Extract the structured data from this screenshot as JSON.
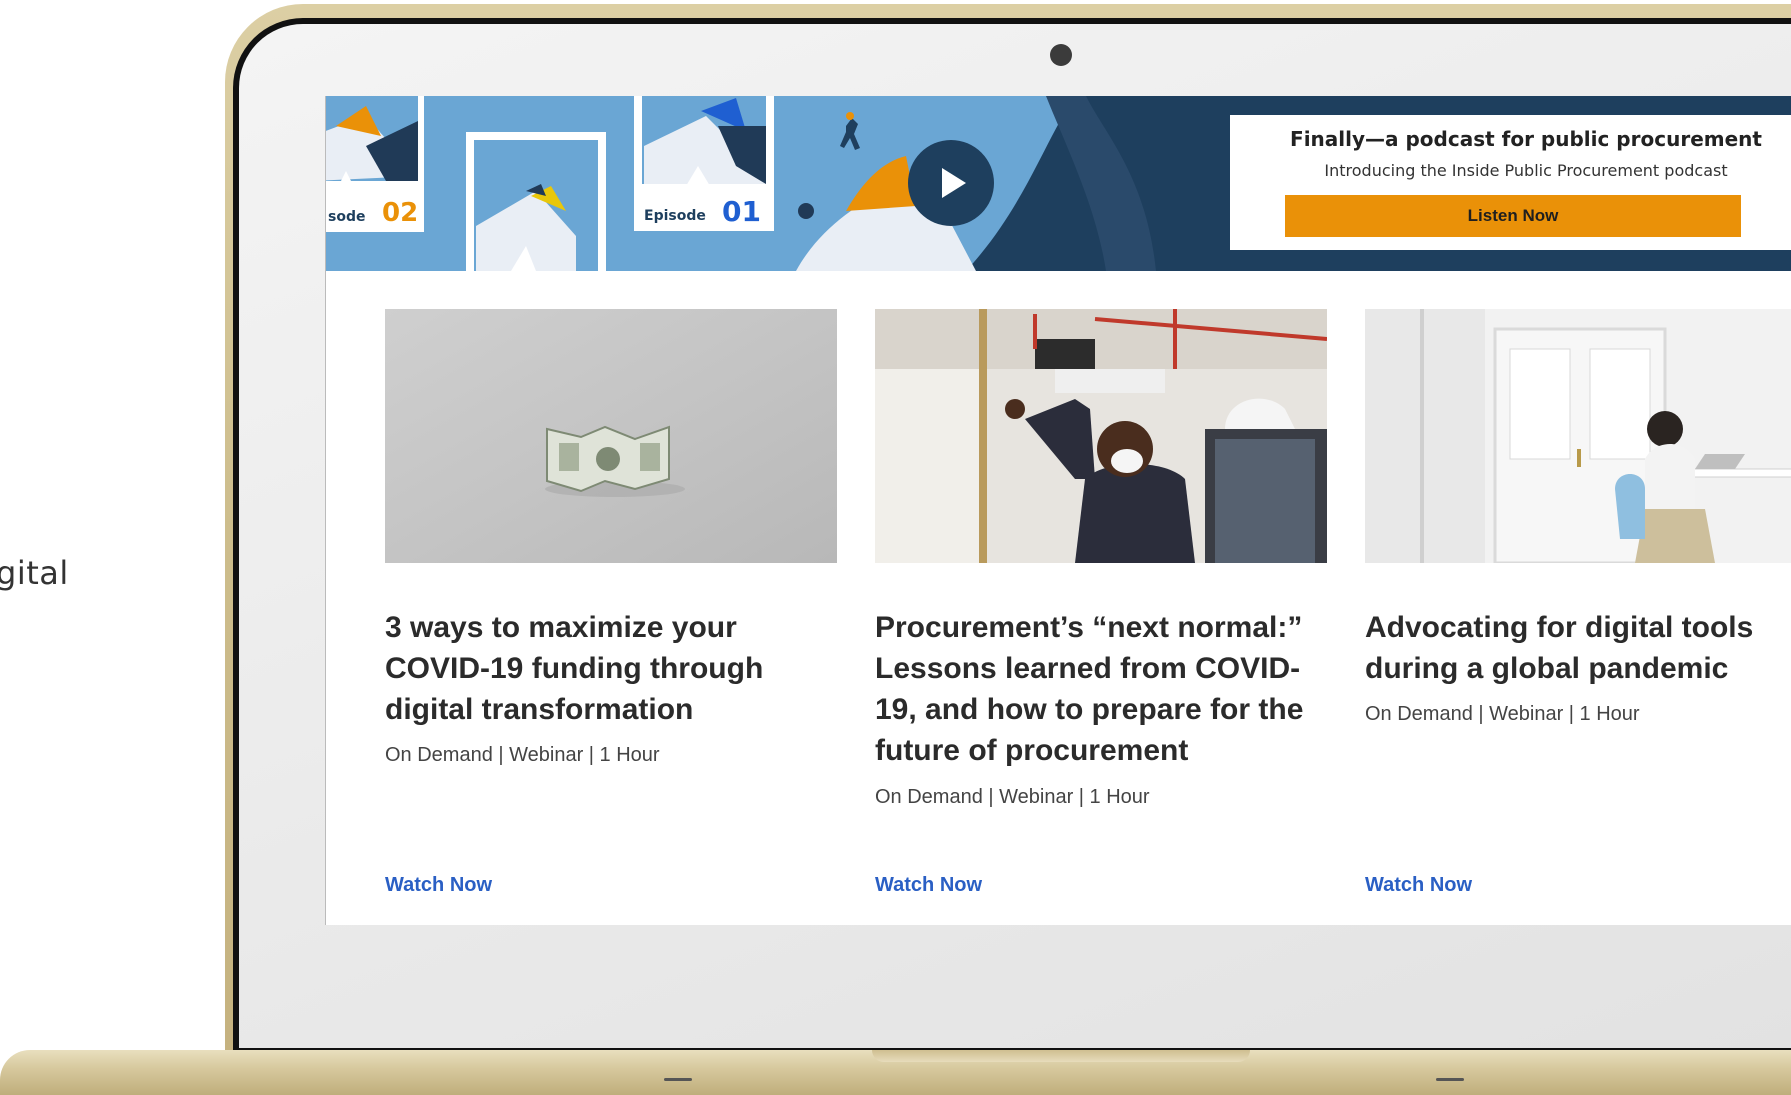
{
  "side_text": "gital",
  "promo": {
    "title": "Finally—a podcast for public procurement",
    "subtitle": "Introducing the Inside Public Procurement podcast",
    "button_label": "Listen Now"
  },
  "banner": {
    "episode_a_label": "sode",
    "episode_a_number": "02",
    "episode_b_label": "Episode",
    "episode_b_number": "01"
  },
  "cards": [
    {
      "title": "3 ways to maximize your COVID-19 funding through digital transformation",
      "meta": "On Demand  |  Webinar  |  1 Hour",
      "link": "Watch Now"
    },
    {
      "title": "Procurement’s “next normal:” Lessons learned from COVID-19, and how to prepare for the future of procurement",
      "meta": "On Demand  |  Webinar  |  1 Hour",
      "link": "Watch Now"
    },
    {
      "title": "Advocating for digital tools during a global pandemic",
      "meta": "On Demand  |  Webinar  |  1 Hour",
      "link": "Watch Now"
    }
  ],
  "colors": {
    "accent_orange": "#ea9108",
    "link_blue": "#2a5fc4",
    "banner_navy": "#1e3f5e",
    "banner_sky": "#6aa6d4"
  }
}
